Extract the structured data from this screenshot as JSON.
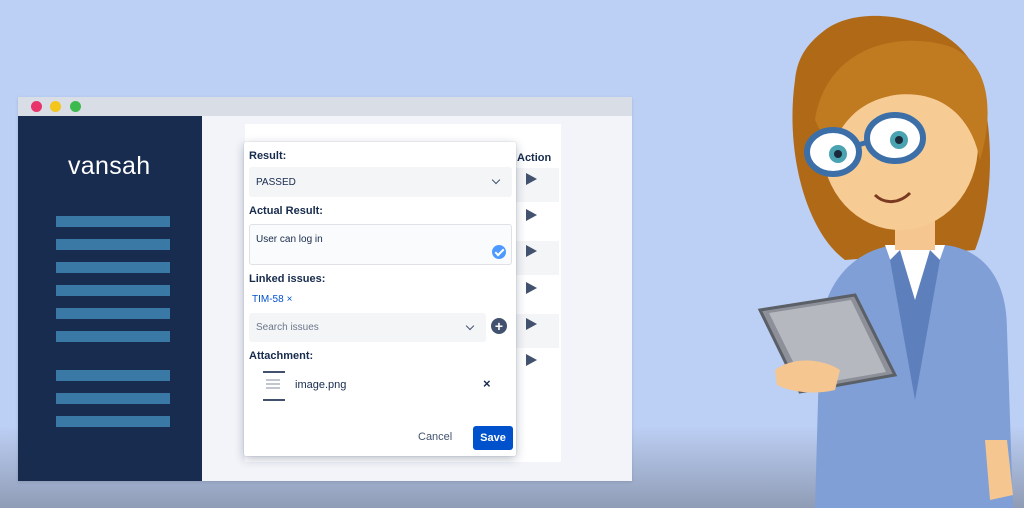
{
  "app": {
    "logo": "vansah"
  },
  "table": {
    "action_header": "Action"
  },
  "modal": {
    "result_label": "Result:",
    "result_value": "PASSED",
    "actual_result_label": "Actual Result:",
    "actual_result_value": "User can log in",
    "linked_issues_label": "Linked issues:",
    "linked_issue_tag": "TIM-58",
    "tag_remove": "×",
    "search_placeholder": "Search issues",
    "add_icon": "+",
    "attachment_label": "Attachment:",
    "attachment_name": "image.png",
    "remove_attachment": "×",
    "cancel_label": "Cancel",
    "save_label": "Save"
  },
  "colors": {
    "accent": "#0052cc",
    "sidebar": "#182c4f",
    "sidebar_bars": "#3a79a5",
    "background": "#bcd0f6"
  }
}
